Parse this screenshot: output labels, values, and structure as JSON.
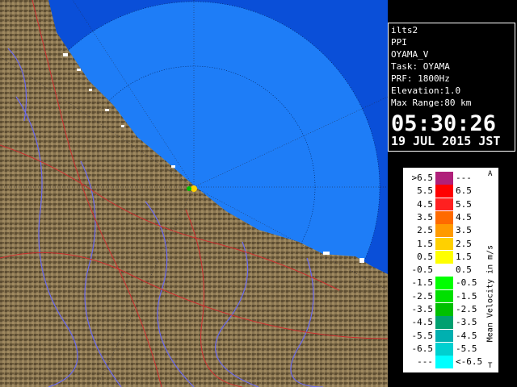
{
  "info": {
    "lines": [
      "ilts2",
      "PPI",
      "OYAMA_V",
      "Task: OYAMA",
      "PRF: 1800Hz",
      "Elevation:1.0",
      "Max Range:80 km"
    ],
    "time": "05:30:26",
    "date": "19 JUL 2015 JST"
  },
  "legend": {
    "title": "Mean Velocity in m/s",
    "corner_top": "A",
    "corner_bottom": "T",
    "rows": [
      {
        "lo": ">6.5",
        "hi": "---",
        "color": "#b0207a"
      },
      {
        "lo": "5.5",
        "hi": "6.5",
        "color": "#ff0000"
      },
      {
        "lo": "4.5",
        "hi": "5.5",
        "color": "#ff2020"
      },
      {
        "lo": "3.5",
        "hi": "4.5",
        "color": "#ff6a00"
      },
      {
        "lo": "2.5",
        "hi": "3.5",
        "color": "#ff9a00"
      },
      {
        "lo": "1.5",
        "hi": "2.5",
        "color": "#ffd000"
      },
      {
        "lo": "0.5",
        "hi": "1.5",
        "color": "#ffff00"
      },
      {
        "lo": "-0.5",
        "hi": "0.5",
        "color": "#ffffff"
      },
      {
        "lo": "-1.5",
        "hi": "-0.5",
        "color": "#00ff00"
      },
      {
        "lo": "-2.5",
        "hi": "-1.5",
        "color": "#00e000"
      },
      {
        "lo": "-3.5",
        "hi": "-2.5",
        "color": "#00c000"
      },
      {
        "lo": "-4.5",
        "hi": "-3.5",
        "color": "#00a070"
      },
      {
        "lo": "-5.5",
        "hi": "-4.5",
        "color": "#00b0b0"
      },
      {
        "lo": "-6.5",
        "hi": "-5.5",
        "color": "#00d0d0"
      },
      {
        "lo": "---",
        "hi": "<-6.5",
        "color": "#00ffff"
      }
    ]
  },
  "map": {
    "sea_color": "#0a4fd8",
    "echo_color": "#1e7df7",
    "land_color": "#7a6a4a",
    "radar_site_label": ""
  }
}
